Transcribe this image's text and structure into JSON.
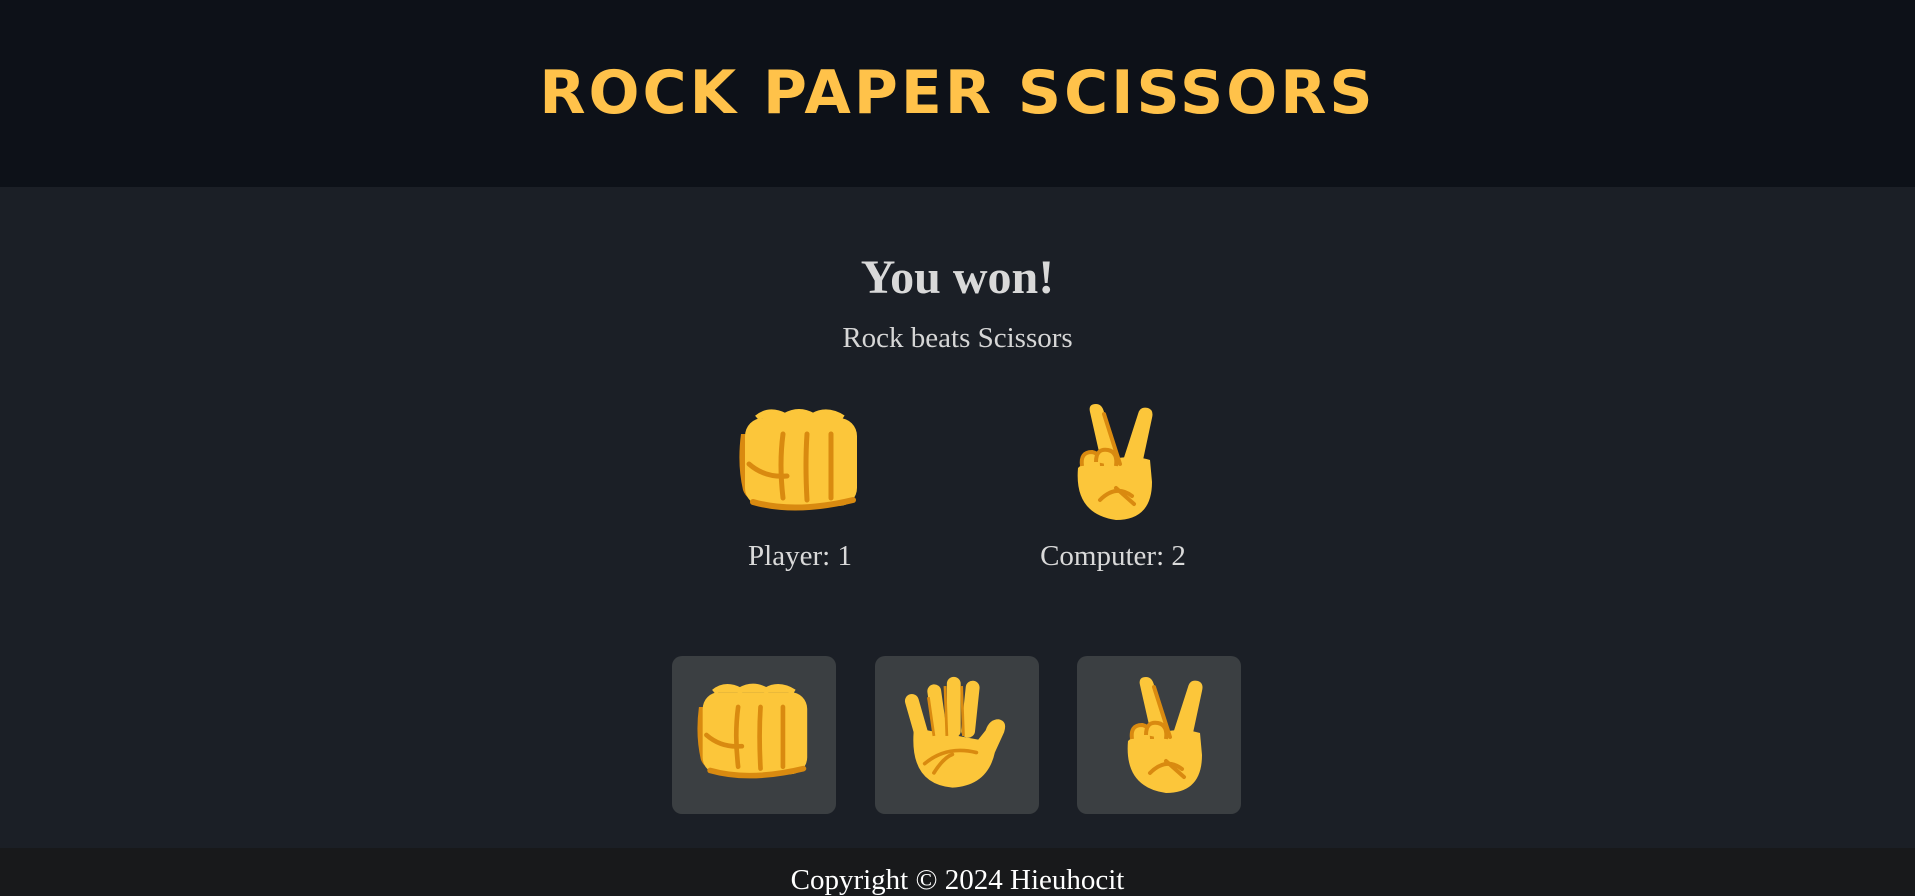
{
  "header": {
    "title": "ROCK PAPER SCISSORS"
  },
  "result": {
    "title": "You won!",
    "detail": "Rock beats Scissors"
  },
  "score": {
    "player_label": "Player: 1",
    "computer_label": "Computer: 2",
    "player_choice_icon": "fist-icon",
    "computer_choice_icon": "victory-hand-icon"
  },
  "choices": [
    {
      "icon": "fist-icon"
    },
    {
      "icon": "raised-hand-icon"
    },
    {
      "icon": "victory-hand-icon"
    }
  ],
  "footer": {
    "text": "Copyright © 2024 Hieuhocit"
  },
  "colors": {
    "accent": "#ffc24a",
    "header_bg": "#0d1118",
    "page_bg": "#1b1f26",
    "button_bg": "#3b3f42",
    "footer_bg": "#18191b",
    "skin": "#fcc63a",
    "skin_shadow": "#d98a10"
  }
}
